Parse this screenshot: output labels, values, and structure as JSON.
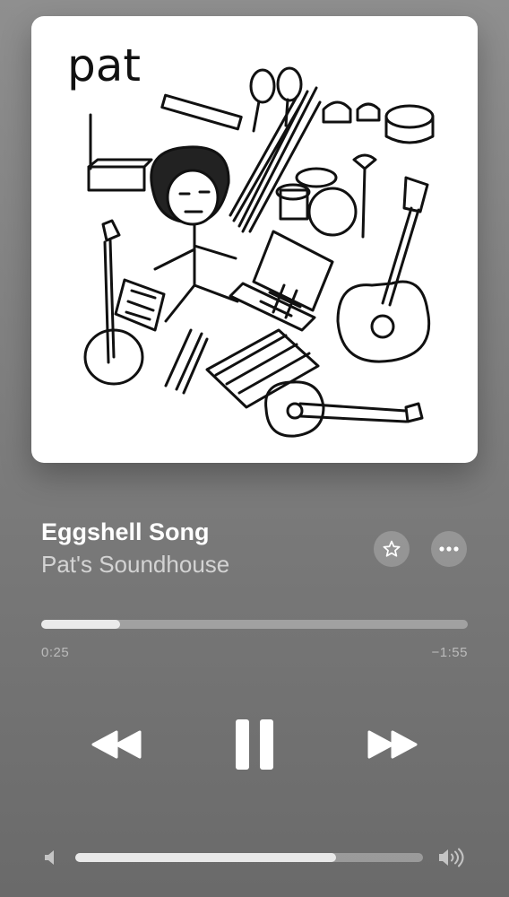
{
  "artwork": {
    "label": "pat"
  },
  "track": {
    "title": "Eggshell Song",
    "artist": "Pat's Soundhouse"
  },
  "actions": {
    "favorite_icon": "star-icon",
    "more_icon": "ellipsis-icon"
  },
  "playback": {
    "elapsed": "0:25",
    "remaining": "−1:55",
    "progress_fraction": 0.185,
    "state": "playing"
  },
  "transport": {
    "rewind_icon": "rewind-icon",
    "pause_icon": "pause-icon",
    "forward_icon": "fast-forward-icon"
  },
  "volume": {
    "level_fraction": 0.75,
    "low_icon": "speaker-low-icon",
    "high_icon": "speaker-high-icon"
  },
  "colors": {
    "background": "#808080",
    "control": "#ffffff"
  }
}
